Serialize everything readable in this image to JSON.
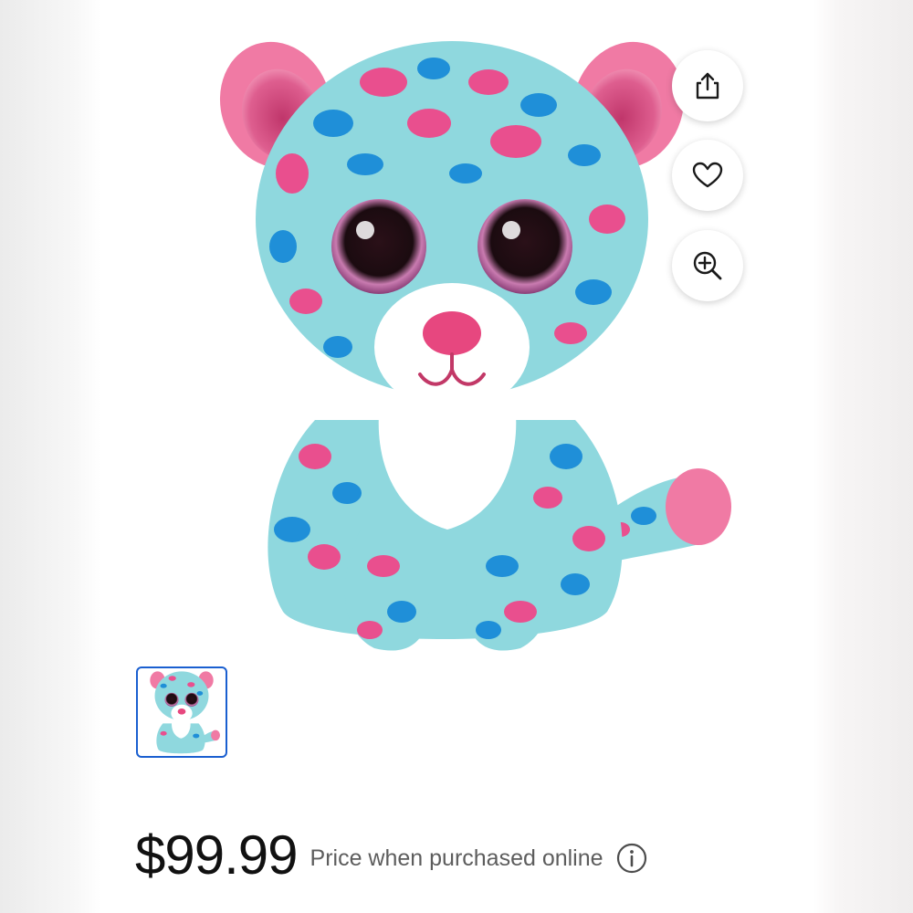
{
  "product": {
    "image_alt": "Blue and pink leopard plush toy with big glitter eyes",
    "price": "$99.99",
    "price_note": "Price when purchased online"
  },
  "actions": {
    "share_icon": "share-icon",
    "favorite_icon": "heart-icon",
    "zoom_icon": "zoom-in-icon"
  },
  "gallery": {
    "selected_index": 0,
    "thumbnail_count": 1
  },
  "info_icon": "info-icon",
  "colors": {
    "fur_base": "#8fd8de",
    "spot_pink": "#e94f8e",
    "spot_blue": "#1f8fd8",
    "ear_pink": "#f07aa4",
    "thumb_border": "#1a5fd0"
  }
}
